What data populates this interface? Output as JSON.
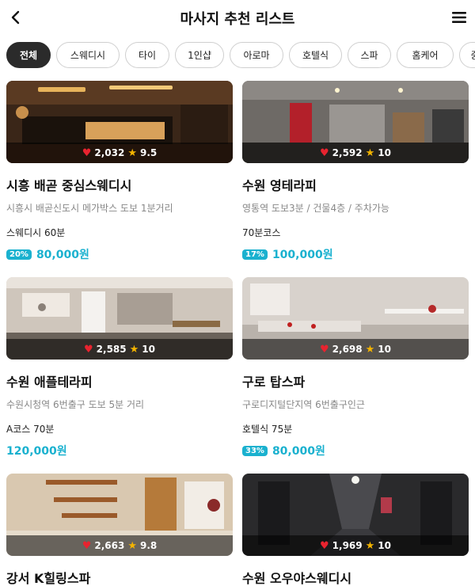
{
  "header": {
    "title": "마사지 추천 리스트",
    "back_icon": "chevron-left-icon",
    "menu_icon": "hamburger-menu-icon"
  },
  "categories": [
    "전체",
    "스웨디시",
    "타이",
    "1인샵",
    "아로마",
    "호텔식",
    "스파",
    "홈케어",
    "중"
  ],
  "active_category": "전체",
  "colors": {
    "accent": "#1ab1cf",
    "heart": "#e8232f",
    "star": "#f4b400",
    "chip_active": "#2b2b2b"
  },
  "shops": [
    {
      "name": "시흥 배곧 중심스웨디시",
      "location": "시흥시 배곧신도시 메가박스 도보 1분거리",
      "likes": "2,032",
      "rating": "9.5",
      "course": "스웨디시 60분",
      "discount": "20%",
      "price": "80,000원"
    },
    {
      "name": "수원 영테라피",
      "location": "영통역 도보3분 / 건물4층 / 주차가능",
      "likes": "2,592",
      "rating": "10",
      "course": "70분코스",
      "discount": "17%",
      "price": "100,000원"
    },
    {
      "name": "수원 애플테라피",
      "location": "수원시청역 6번출구 도보 5분 거리",
      "likes": "2,585",
      "rating": "10",
      "course": "A코스 70분",
      "discount": "",
      "price": "120,000원"
    },
    {
      "name": "구로 탑스파",
      "location": "구로디지털단지역 6번출구인근",
      "likes": "2,698",
      "rating": "10",
      "course": "호텔식 75분",
      "discount": "33%",
      "price": "80,000원"
    },
    {
      "name": "강서 K힐링스파",
      "location": "",
      "likes": "2,663",
      "rating": "9.8",
      "course": "",
      "discount": "",
      "price": ""
    },
    {
      "name": "수원 오우야스웨디시",
      "location": "",
      "likes": "1,969",
      "rating": "10",
      "course": "",
      "discount": "",
      "price": ""
    }
  ]
}
